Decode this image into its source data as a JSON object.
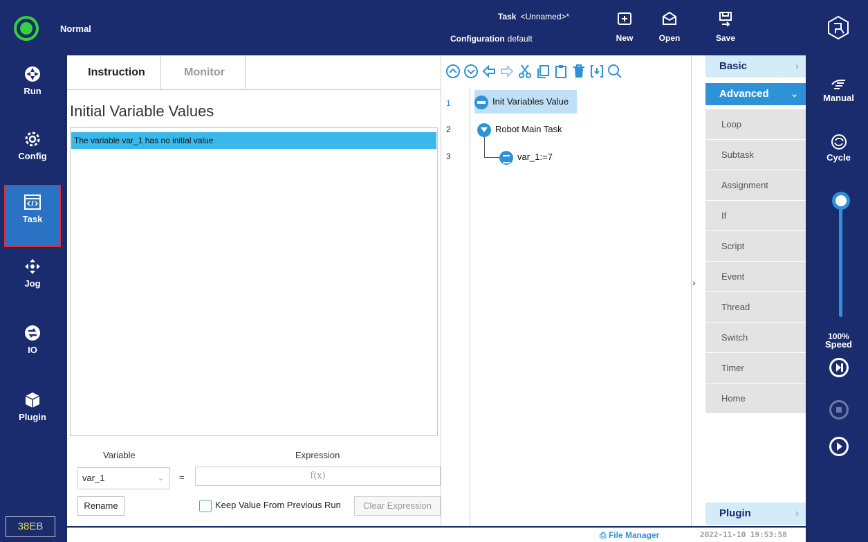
{
  "header": {
    "mode": "Normal",
    "task_label": "Task",
    "task_value": "<Unnamed>*",
    "config_label": "Configuration",
    "config_value": "default",
    "buttons": {
      "new": "New",
      "open": "Open",
      "save": "Save"
    },
    "status_color": "#35d13f"
  },
  "nav": {
    "items": [
      {
        "label": "Run",
        "icon": "target-icon"
      },
      {
        "label": "Config",
        "icon": "gear-icon"
      },
      {
        "label": "Task",
        "icon": "code-window-icon",
        "active": true
      },
      {
        "label": "Jog",
        "icon": "move-arrows-icon"
      },
      {
        "label": "IO",
        "icon": "io-arrows-icon"
      },
      {
        "label": "Plugin",
        "icon": "cube-icon"
      }
    ],
    "version": "38EB"
  },
  "editor": {
    "tabs": {
      "instruction": "Instruction",
      "monitor": "Monitor"
    },
    "title": "Initial Variable Values",
    "list_rows": [
      "The variable var_1 has no initial value"
    ],
    "variable_label": "Variable",
    "expression_label": "Expression",
    "variable_value": "var_1",
    "equals": "=",
    "expression_placeholder": "f(x)",
    "rename_label": "Rename",
    "keep_label": "Keep Value From Previous Run",
    "clear_label": "Clear Expression"
  },
  "tree": {
    "lines": [
      "1",
      "2",
      "3"
    ],
    "nodes": [
      "Init Variables Value",
      "Robot Main Task",
      "var_1:=7"
    ]
  },
  "palette": {
    "basic": "Basic",
    "advanced": "Advanced",
    "items": [
      "Loop",
      "Subtask",
      "Assignment",
      "If",
      "Script",
      "Event",
      "Thread",
      "Switch",
      "Timer",
      "Home"
    ],
    "plugin": "Plugin"
  },
  "status": {
    "file_manager": "File Manager",
    "datetime": "2022-11-10 19:53:58"
  },
  "right": {
    "manual": "Manual",
    "cycle": "Cycle",
    "speed_value": "100%",
    "speed_label": "Speed",
    "speed_fraction": 1.0
  }
}
